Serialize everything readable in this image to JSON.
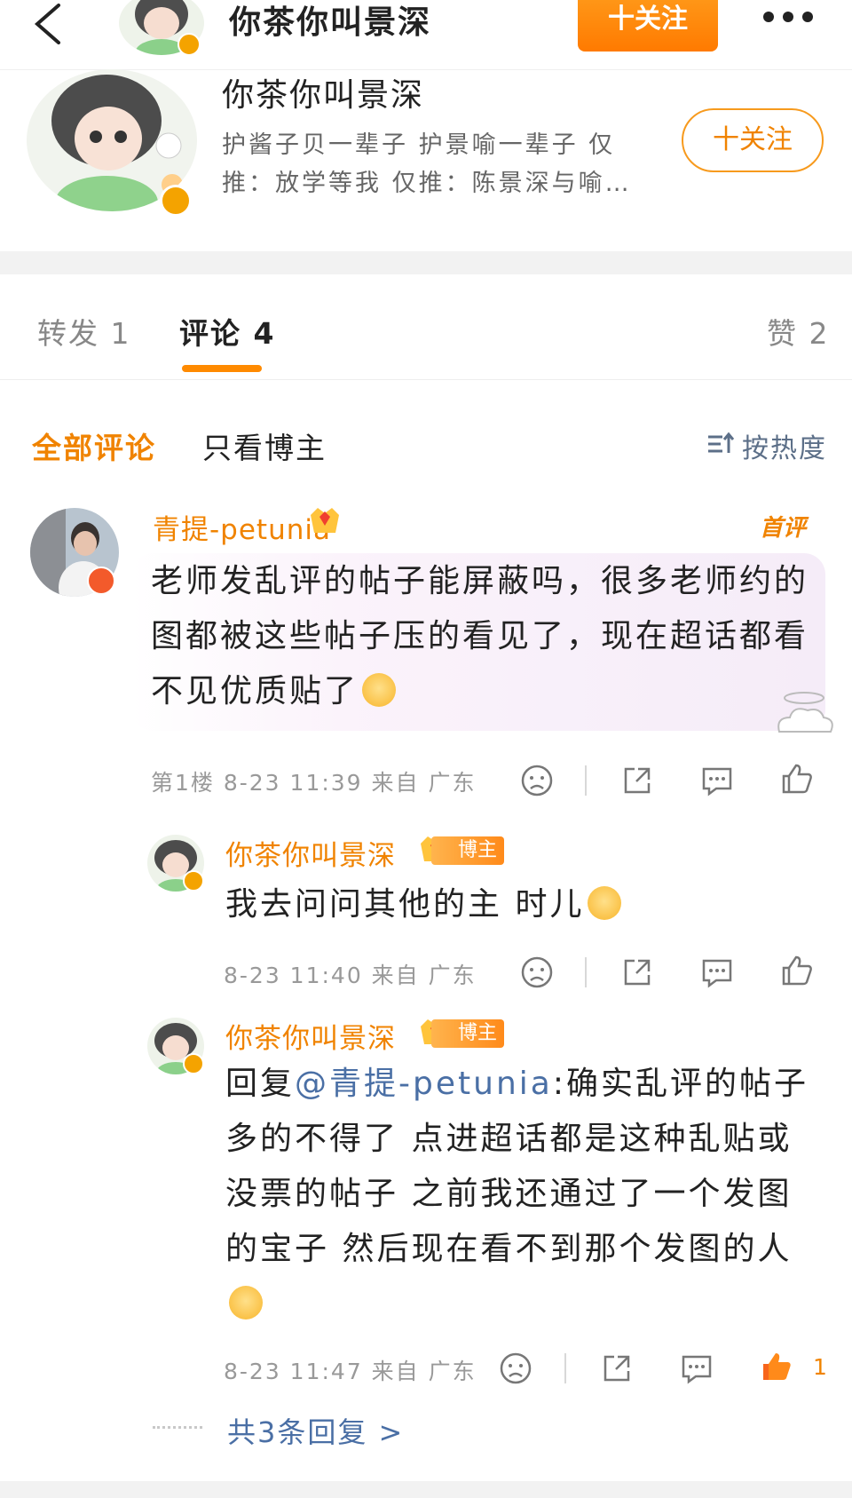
{
  "topbar": {
    "name": "你茶你叫景深",
    "follow_label": "十关注"
  },
  "profile": {
    "name": "你茶你叫景深",
    "desc": "护酱子贝一辈子 护景喻一辈子 仅推：放学等我 仅推：陈景深与喻…",
    "follow_label": "十关注"
  },
  "tabs": {
    "repost": "转发 1",
    "comments": "评论 4",
    "likes": "赞 2"
  },
  "filters": {
    "all": "全部评论",
    "op_only": "只看博主",
    "sort": "按热度"
  },
  "comments": [
    {
      "name": "青提-petunia",
      "first_tag": "首评",
      "text": "老师发乱评的帖子能屏蔽吗，很多老师约的图都被这些帖子压的看见了，现在超话都看不见优质贴了",
      "meta": "第1楼 8-23 11:39 来自 广东"
    },
    {
      "name": "你茶你叫景深",
      "op_tag": "博主",
      "text": "我去问问其他的主 时儿",
      "meta": "8-23 11:40 来自 广东"
    },
    {
      "name": "你茶你叫景深",
      "op_tag": "博主",
      "reply_prefix": "回复",
      "mention": "@青提-petunia",
      "text": ":确实乱评的帖子多的不得了 点进超话都是这种乱贴或没票的帖子 之前我还通过了一个发图的宝子 然后现在看不到那个发图的人",
      "meta": "8-23 11:47 来自 广东",
      "like_count": "1"
    }
  ],
  "replies_link": "共3条回复 >",
  "colors": {
    "accent": "#ff8a00",
    "name": "#f08300",
    "link": "#4a6fa5"
  }
}
